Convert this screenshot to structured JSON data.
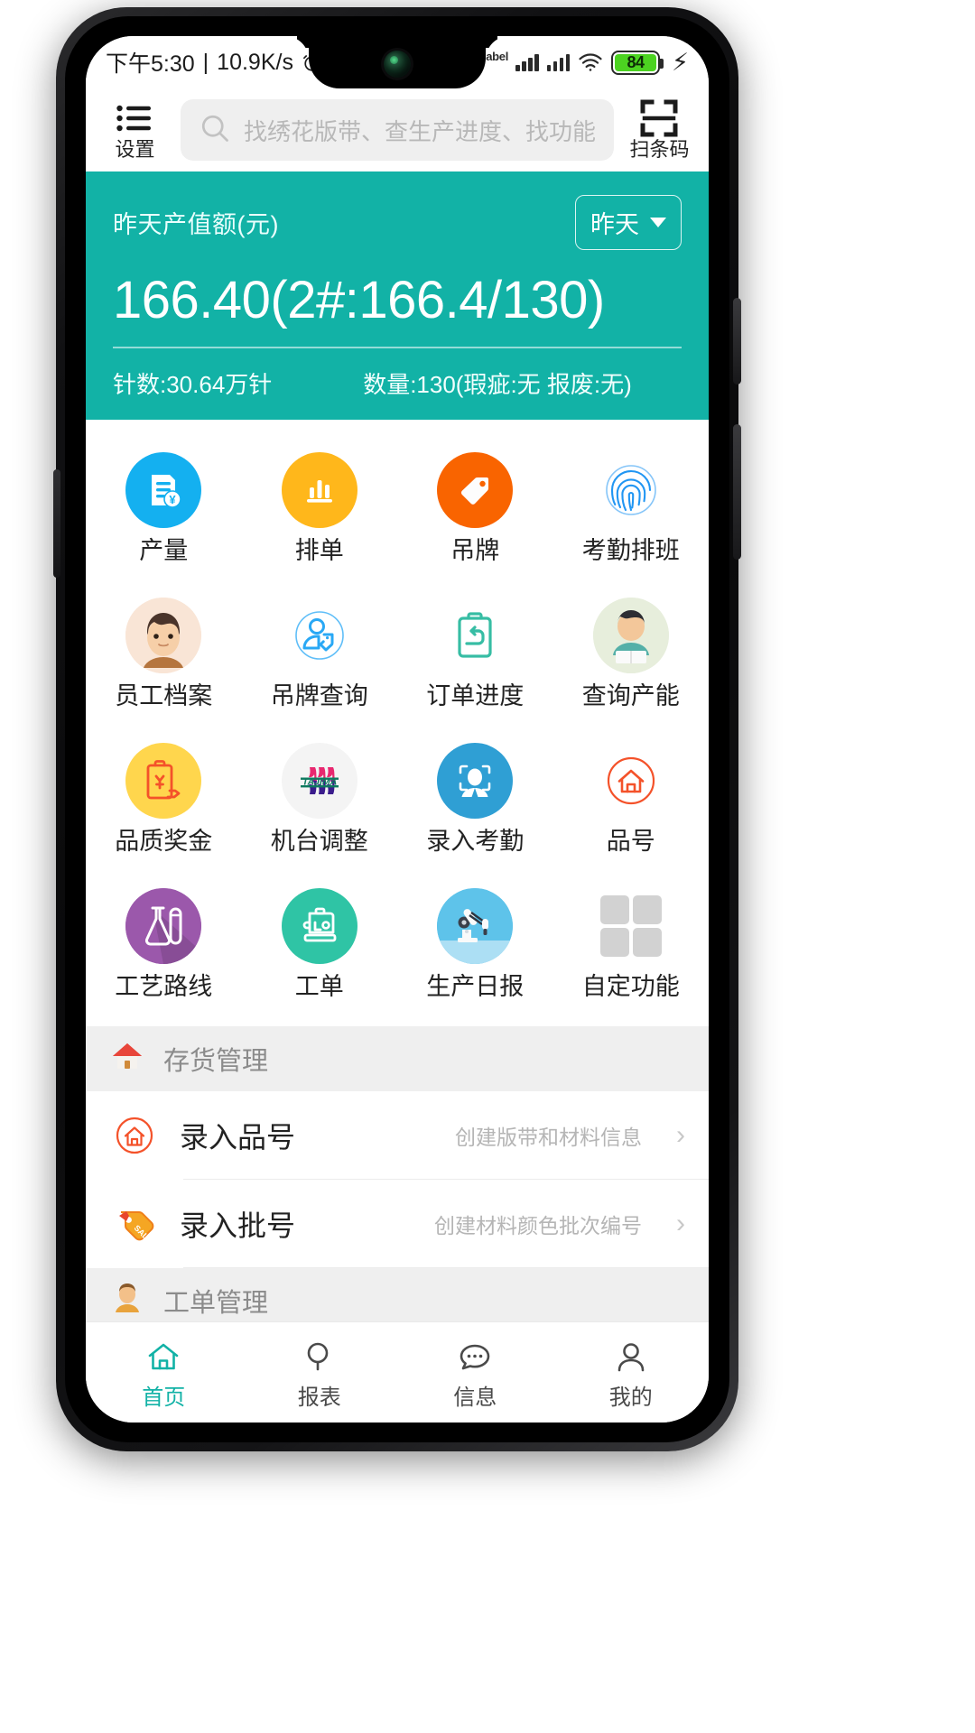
{
  "status_bar": {
    "time": "下午5:30",
    "separator": "|",
    "network_speed": "10.9K/s",
    "battery_level": "84",
    "icons": [
      "alarm-icon",
      "bluetooth-icon",
      "hd-label",
      "signal-icon",
      "signal-icon",
      "wifi-icon",
      "battery-icon",
      "charging-bolt-icon"
    ]
  },
  "header": {
    "settings_label": "设置",
    "scan_label": "扫条码",
    "search_placeholder": "找绣花版带、查生产进度、找功能"
  },
  "banner": {
    "title": "昨天产值额(元)",
    "period_label": "昨天",
    "value": "166.40(2#:166.4/130)",
    "stat_stitches": "针数:30.64万针",
    "stat_quantity": "数量:130(瑕疵:无 报废:无)",
    "accent_color": "#12b2a6"
  },
  "grid": {
    "items": [
      {
        "label": "产量",
        "icon": "invoice-yuan-icon",
        "bg": "#14b0f0"
      },
      {
        "label": "排单",
        "icon": "bar-chart-icon",
        "bg": "#ffb71b"
      },
      {
        "label": "吊牌",
        "icon": "price-tag-icon",
        "bg": "#f96400"
      },
      {
        "label": "考勤排班",
        "icon": "fingerprint-icon",
        "bg": "#ffffff"
      },
      {
        "label": "员工档案",
        "icon": "employee-avatar-icon",
        "bg": "#f7e2d2"
      },
      {
        "label": "吊牌查询",
        "icon": "person-tag-icon",
        "bg": "#ffffff"
      },
      {
        "label": "订单进度",
        "icon": "clipboard-return-icon",
        "bg": "#ffffff"
      },
      {
        "label": "查询产能",
        "icon": "student-reading-icon",
        "bg": "#e6eddc"
      },
      {
        "label": "品质奖金",
        "icon": "clipboard-yuan-icon",
        "bg": "#ffd64d"
      },
      {
        "label": "机台调整",
        "icon": "tajima-logo-icon",
        "bg": "#f4f4f4"
      },
      {
        "label": "录入考勤",
        "icon": "face-scan-person-icon",
        "bg": "#2f9fd4"
      },
      {
        "label": "品号",
        "icon": "house-outline-icon",
        "bg": "#ffffff"
      },
      {
        "label": "工艺路线",
        "icon": "flask-tube-icon",
        "bg": "#9b58ab"
      },
      {
        "label": "工单",
        "icon": "sewing-machine-icon",
        "bg": "#2fc4a5"
      },
      {
        "label": "生产日报",
        "icon": "robot-arm-icon",
        "bg": "#5ec3ea"
      },
      {
        "label": "自定功能",
        "icon": "grid-squares-icon",
        "bg": "#ffffff"
      }
    ]
  },
  "sections": [
    {
      "header": "存货管理",
      "header_icon": "house-emoji-icon",
      "rows": [
        {
          "title": "录入品号",
          "subtitle": "创建版带和材料信息",
          "icon": "house-outline-icon"
        },
        {
          "title": "录入批号",
          "subtitle": "创建材料颜色批次编号",
          "icon": "sale-tag-icon"
        }
      ]
    },
    {
      "header": "工单管理",
      "header_icon": "person-emoji-icon",
      "rows": []
    }
  ],
  "bottom_nav": {
    "items": [
      {
        "label": "首页",
        "icon": "home-icon",
        "active": true
      },
      {
        "label": "报表",
        "icon": "search-icon",
        "active": false
      },
      {
        "label": "信息",
        "icon": "chat-icon",
        "active": false
      },
      {
        "label": "我的",
        "icon": "person-icon",
        "active": false
      }
    ]
  }
}
